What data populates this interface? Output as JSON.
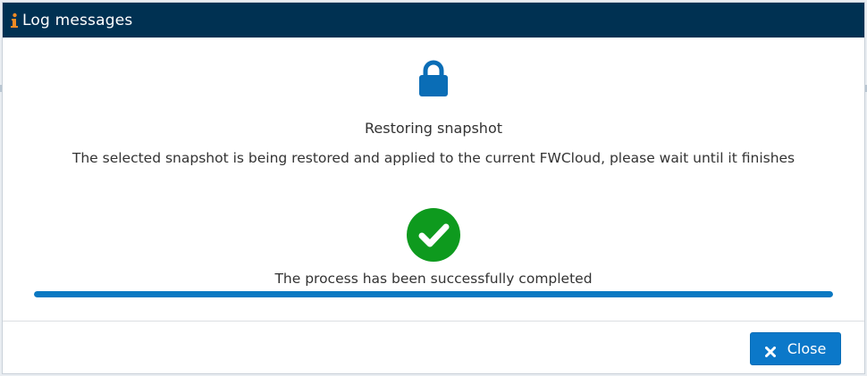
{
  "dialog": {
    "title": "Log messages",
    "title_icon": "info-icon",
    "lock_icon": "lock-icon",
    "heading": "Restoring snapshot",
    "message": "The selected snapshot is being restored and applied to the current FWCloud, please wait until it finishes",
    "status_icon": "check-circle-icon",
    "status_text": "The process has been successfully completed",
    "progress_percent": 100,
    "close_label": "Close",
    "close_icon": "close-icon"
  },
  "colors": {
    "titlebar": "#003152",
    "accent": "#0b78c9",
    "success": "#0e9a1e",
    "info_icon": "#f08a24"
  }
}
